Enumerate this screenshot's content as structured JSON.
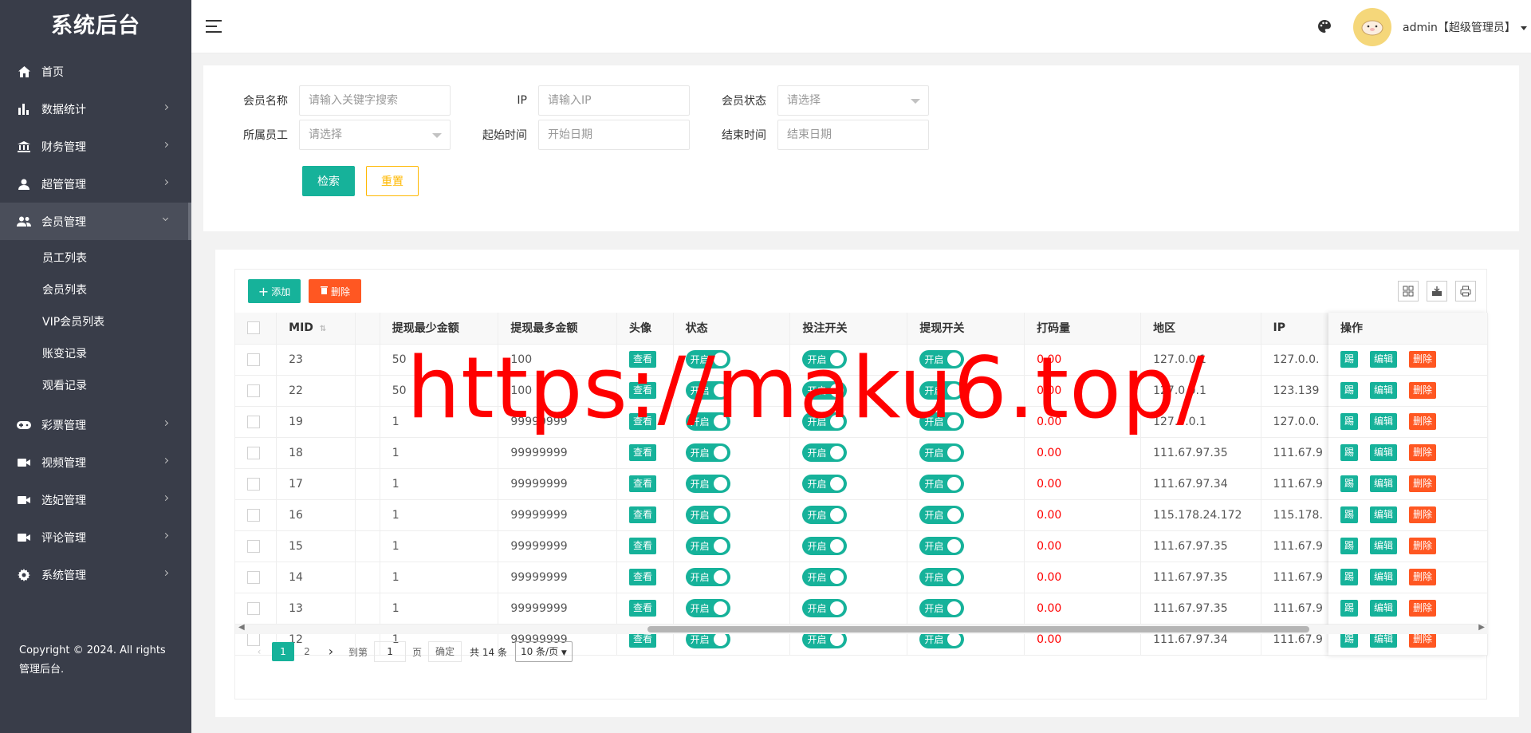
{
  "sidebar": {
    "logo": "系统后台",
    "items": [
      {
        "label": "首页",
        "icon": "home-icon"
      },
      {
        "label": "数据统计",
        "icon": "bar-chart-icon"
      },
      {
        "label": "财务管理",
        "icon": "bank-icon"
      },
      {
        "label": "超管管理",
        "icon": "user-icon"
      },
      {
        "label": "会员管理",
        "icon": "users-icon"
      },
      {
        "label": "彩票管理",
        "icon": "gamepad-icon"
      },
      {
        "label": "视频管理",
        "icon": "video-icon"
      },
      {
        "label": "选妃管理",
        "icon": "video-icon"
      },
      {
        "label": "评论管理",
        "icon": "video-icon"
      },
      {
        "label": "系统管理",
        "icon": "gear-icon"
      }
    ],
    "sub_items": [
      "员工列表",
      "会员列表",
      "VIP会员列表",
      "账变记录",
      "观看记录"
    ],
    "copyright": "Copyright © 2024. All rights 管理后台."
  },
  "header": {
    "user": "admin【超级管理员】"
  },
  "search": {
    "member_name_label": "会员名称",
    "member_name_placeholder": "请输入关键字搜索",
    "ip_label": "IP",
    "ip_placeholder": "请输入IP",
    "status_label": "会员状态",
    "status_placeholder": "请选择",
    "staff_label": "所属员工",
    "staff_placeholder": "请选择",
    "start_label": "起始时间",
    "start_placeholder": "开始日期",
    "end_label": "结束时间",
    "end_placeholder": "结束日期",
    "search_btn": "检索",
    "reset_btn": "重置"
  },
  "toolbar": {
    "add": "添加",
    "delete": "删除"
  },
  "table": {
    "headers": [
      "MID",
      "提现最少金额",
      "提现最多金额",
      "头像",
      "状态",
      "投注开关",
      "提现开关",
      "打码量",
      "地区",
      "IP",
      "操作"
    ],
    "view_label": "查看",
    "switch_label": "开启",
    "op_kick": "踢",
    "op_edit": "编辑",
    "op_delete": "删除",
    "rows": [
      {
        "mid": "23",
        "min": "50",
        "max": "100",
        "code": "0.00",
        "region": "127.0.0.1",
        "ip": "127.0.0."
      },
      {
        "mid": "22",
        "min": "50",
        "max": "100",
        "code": "0.00",
        "region": "127.0.0.1",
        "ip": "123.139"
      },
      {
        "mid": "19",
        "min": "1",
        "max": "99999999",
        "code": "0.00",
        "region": "127.0.0.1",
        "ip": "127.0.0."
      },
      {
        "mid": "18",
        "min": "1",
        "max": "99999999",
        "code": "0.00",
        "region": "111.67.97.35",
        "ip": "111.67.9"
      },
      {
        "mid": "17",
        "min": "1",
        "max": "99999999",
        "code": "0.00",
        "region": "111.67.97.34",
        "ip": "111.67.9"
      },
      {
        "mid": "16",
        "min": "1",
        "max": "99999999",
        "code": "0.00",
        "region": "115.178.24.172",
        "ip": "115.178."
      },
      {
        "mid": "15",
        "min": "1",
        "max": "99999999",
        "code": "0.00",
        "region": "111.67.97.35",
        "ip": "111.67.9"
      },
      {
        "mid": "14",
        "min": "1",
        "max": "99999999",
        "code": "0.00",
        "region": "111.67.97.35",
        "ip": "111.67.9"
      },
      {
        "mid": "13",
        "min": "1",
        "max": "99999999",
        "code": "0.00",
        "region": "111.67.97.35",
        "ip": "111.67.9"
      },
      {
        "mid": "12",
        "min": "1",
        "max": "99999999",
        "code": "0.00",
        "region": "111.67.97.34",
        "ip": "111.67.9"
      }
    ]
  },
  "pager": {
    "pages": [
      "1",
      "2"
    ],
    "goto_label": "到第",
    "goto_value": "1",
    "page_unit": "页",
    "confirm": "确定",
    "total": "共 14 条",
    "per_page": "10 条/页"
  },
  "watermark": "https://maku6.top/"
}
